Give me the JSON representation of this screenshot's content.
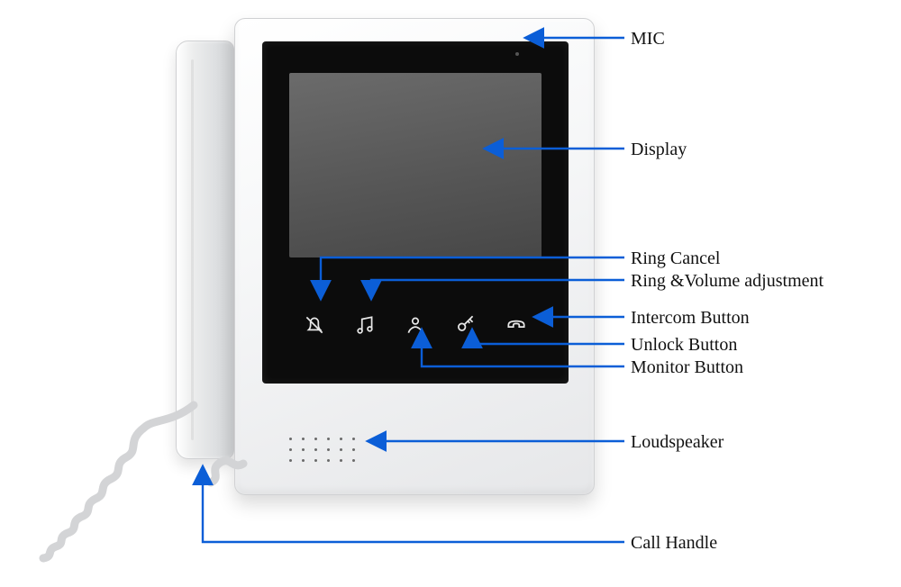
{
  "labels": {
    "mic": "MIC",
    "display": "Display",
    "ring_cancel": "Ring Cancel",
    "ring_volume": "Ring &Volume adjustment",
    "intercom": "Intercom Button",
    "unlock": "Unlock Button",
    "monitor": "Monitor Button",
    "loudspeaker": "Loudspeaker",
    "call_handle": "Call Handle"
  },
  "colors": {
    "arrow": "#0b5ed7"
  }
}
